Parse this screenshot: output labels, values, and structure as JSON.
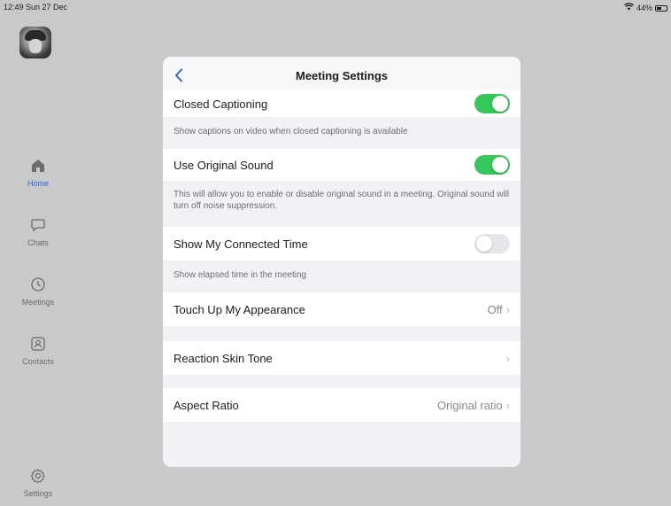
{
  "status_bar": {
    "time": "12:49  Sun 27 Dec",
    "battery": "44%",
    "wifi_icon": "wifi-icon",
    "battery_icon": "battery-icon"
  },
  "sidebar": {
    "items": [
      {
        "label": "Home",
        "icon": "home-icon",
        "active": true
      },
      {
        "label": "Chats",
        "icon": "chat-bubble-icon",
        "active": false
      },
      {
        "label": "Meetings",
        "icon": "clock-icon",
        "active": false
      },
      {
        "label": "Contacts",
        "icon": "contact-card-icon",
        "active": false
      },
      {
        "label": "Settings",
        "icon": "gear-icon",
        "active": false
      }
    ]
  },
  "modal": {
    "title": "Meeting Settings",
    "back_icon": "chevron-left-icon",
    "settings": {
      "closed_captioning": {
        "label": "Closed Captioning",
        "enabled": true,
        "description": "Show captions on video when closed captioning is available"
      },
      "original_sound": {
        "label": "Use Original Sound",
        "enabled": true,
        "description": "This will allow you to enable or disable original sound in a meeting. Original sound will turn off noise suppression."
      },
      "connected_time": {
        "label": "Show My Connected Time",
        "enabled": false,
        "description": "Show elapsed time in the meeting"
      },
      "touch_up": {
        "label": "Touch Up My Appearance",
        "value": "Off"
      },
      "skin_tone": {
        "label": "Reaction Skin Tone",
        "value": ""
      },
      "aspect_ratio": {
        "label": "Aspect Ratio",
        "value": "Original ratio"
      }
    }
  },
  "colors": {
    "accent": "#2b66d6",
    "toggle_on": "#34c759",
    "toggle_off": "#e5e5ea",
    "backdrop": "#c9c9ca"
  }
}
